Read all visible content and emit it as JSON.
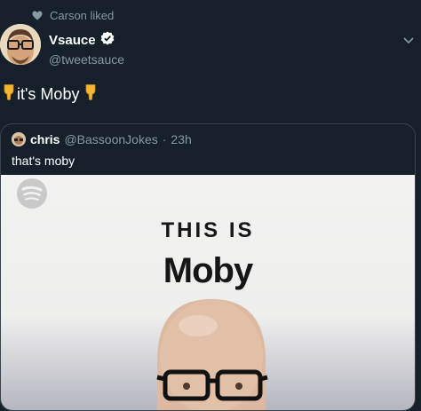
{
  "social_context": {
    "text": "Carson liked",
    "icon": "heart-icon"
  },
  "author": {
    "display_name": "Vsauce",
    "handle": "@tweetsauce",
    "verified": true
  },
  "tweet": {
    "text": "it's Moby",
    "emoji": "pointing-down-emoji"
  },
  "quote": {
    "name": "chris",
    "handle": "@BassoonJokes",
    "separator": "·",
    "time": "23h",
    "text": "that's moby",
    "media": {
      "title_small": "THIS IS",
      "title_large": "Moby",
      "logo": "spotify-icon"
    }
  },
  "colors": {
    "background": "#15202b",
    "secondary_text": "#8899a6",
    "border": "#38444d"
  }
}
